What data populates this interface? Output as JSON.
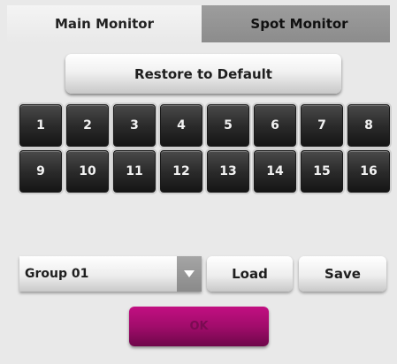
{
  "tabs": [
    {
      "label": "Main Monitor",
      "active": true
    },
    {
      "label": "Spot Monitor",
      "active": false
    }
  ],
  "restore_button": "Restore to Default",
  "channels": [
    "1",
    "2",
    "3",
    "4",
    "5",
    "6",
    "7",
    "8",
    "9",
    "10",
    "11",
    "12",
    "13",
    "14",
    "15",
    "16"
  ],
  "group_select": {
    "value": "Group 01",
    "icon": "triangle-down-icon"
  },
  "load_button": "Load",
  "save_button": "Save",
  "ok_button": "OK",
  "colors": {
    "accent": "#a10c6b",
    "channel_button": "#2b2b2b",
    "inactive_tab": "#8c8c8c",
    "panel_bg": "#e9e9e9"
  }
}
